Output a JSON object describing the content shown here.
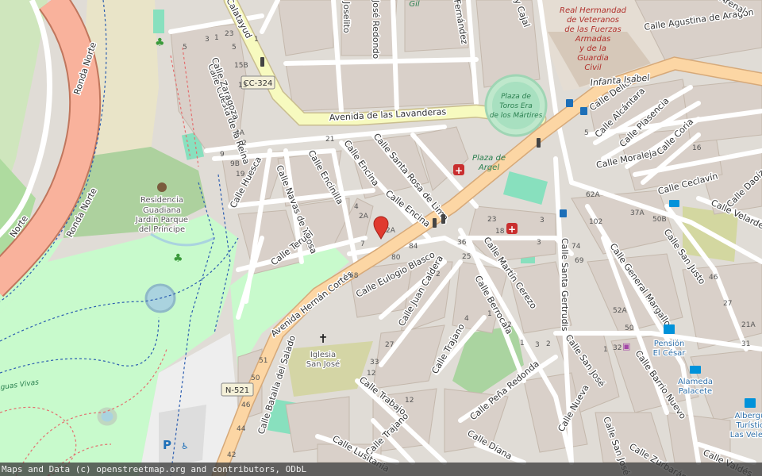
{
  "map": {
    "roads": {
      "ronda_norte": "Ronda Norte",
      "av_lavanderas": "Avenida de las Lavanderas",
      "av_hernan_cortes": "Avenida Hernán Cortés",
      "calatayud": "Calatayud",
      "jose_redondo": "José Redondo",
      "joselito": "Joselito",
      "fernandez": "Fernández",
      "cajal": "y Cajal",
      "agustina": "Calle Agustina de Aragón",
      "arenal": "Arenal",
      "cuesta_reina": "Calle Cuesta de la Reina",
      "zaragoza": "Calle Zaragoza",
      "huesca": "Calle Huesca",
      "navas_tolosa": "Calle Navas de Tolosa",
      "encinilla": "Calle Encinilla",
      "encina1": "Calle Encina",
      "encina2": "Calle Encina",
      "santa_rosa": "Calle Santa Rosa de Lima",
      "teruel": "Calle Teruel",
      "eulogio": "Calle Eulogio Blasco",
      "juan_caldera": "Calle Juan Caldera",
      "martin_cerezo": "Calle Martín Cerezo",
      "berrocala": "Calle Berrocala",
      "santa_gertrudis": "Calle Santa Gertrudis",
      "trajano1": "Calle Trajano",
      "trajano2": "Calle Trajano",
      "trabajo": "Calle Trabajo",
      "batalla_salado": "Calle Batalla del Salado",
      "pena_redonda": "Calle Peña Redonda",
      "san_jose1": "Calle San José",
      "san_jose2": "Calle San José",
      "nueva": "Calle Nueva",
      "diana": "Calle Diana",
      "lusitania": "Calle Lusitania",
      "zurbaran": "Calle Zurbarán",
      "barrio_nuevo": "Calle Barrio Nuevo",
      "general_margallo": "Calle General Margallo",
      "san_justo": "Calle San Justo",
      "ceclavin": "Calle Ceclavín",
      "moraleja": "Calle Moraleja",
      "coria": "Calle Coria",
      "plasencia": "Calle Plasencia",
      "alcantara": "Calle Alcántara",
      "delicias": "Calle Delicias",
      "infanta": "Infanta Isabel",
      "velarde": "Calle Velarde",
      "daoiz": "Calle Daoíz",
      "valdes": "Calle Valdés",
      "aguas_vivas": "Aguas Vivas",
      "gil": "Gil",
      "norte_edge": "Norte"
    },
    "shields": {
      "cc324": "CC-324",
      "n521": "N-521"
    },
    "pois": {
      "residencia": [
        "Residencia",
        "Guadiana",
        "Jardín Parque",
        "del Príncipe"
      ],
      "plaza_toros": [
        "Plaza de",
        "Toros Era",
        "de los Mártires"
      ],
      "plaza_argel": [
        "Plaza de",
        "Argel"
      ],
      "hermandad": [
        "Real Hermandad",
        "de Veteranos",
        "de las Fuerzas",
        "Armadas",
        "y de la",
        "Guardia",
        "Civil"
      ],
      "iglesia": [
        "Iglesia",
        "San José"
      ],
      "pension": [
        "Pensión",
        "El César"
      ],
      "alameda": [
        "Alameda",
        "Palacete"
      ],
      "albergue": [
        "Albergue",
        "Turístico",
        "Las Veletas"
      ]
    },
    "house_numbers": [
      "23",
      "3",
      "1",
      "5",
      "5",
      "15B",
      "13",
      "4A",
      "2",
      "9",
      "9B",
      "19",
      "21",
      "4",
      "2A",
      "2A",
      "7",
      "80",
      "84",
      "68",
      "36",
      "25",
      "18",
      "23",
      "3",
      "102",
      "62A",
      "37A",
      "50B",
      "16",
      "74",
      "69",
      "46",
      "27",
      "21A",
      "31",
      "52A",
      "50",
      "32",
      "1",
      "4",
      "27",
      "33",
      "12",
      "51",
      "50",
      "46",
      "44",
      "42",
      "12",
      "2",
      "1",
      "2",
      "1",
      "3",
      "2",
      "5",
      "3",
      "1",
      "7"
    ],
    "colors": {
      "primary_road": "#fcd6a4",
      "secondary_road": "#f7fabf",
      "trunk_road": "#f9b29c",
      "park": "#c8facc",
      "pitch": "#88e0be",
      "building": "#d9d0c9",
      "water": "#aad3df",
      "medical": "#c92e2e",
      "tourism": "#0092da",
      "marker": "#e03a2f"
    }
  },
  "attribution": "Maps and Data (c) openstreetmap.org and contributors, ODbL"
}
